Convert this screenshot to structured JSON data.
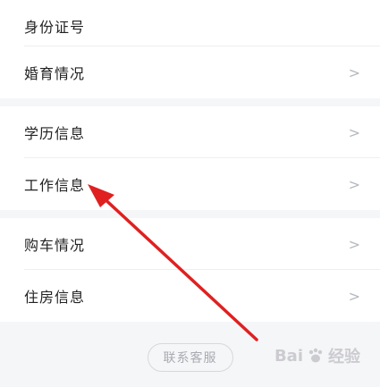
{
  "rows_group1": [
    {
      "label": "身份证号",
      "chevron": ""
    },
    {
      "label": "婚育情况",
      "chevron": ">"
    }
  ],
  "rows_group2": [
    {
      "label": "学历信息",
      "chevron": ">"
    },
    {
      "label": "工作信息",
      "chevron": ">"
    }
  ],
  "rows_group3": [
    {
      "label": "购车情况",
      "chevron": ">"
    },
    {
      "label": "住房信息",
      "chevron": ">"
    }
  ],
  "contact_button": "联系客服",
  "watermark": {
    "text_left": "Bai",
    "text_right": "经验"
  },
  "colors": {
    "background": "#f5f6f8",
    "arrow": "#e02020",
    "text": "#222222",
    "chevron": "#b5b8bd"
  }
}
